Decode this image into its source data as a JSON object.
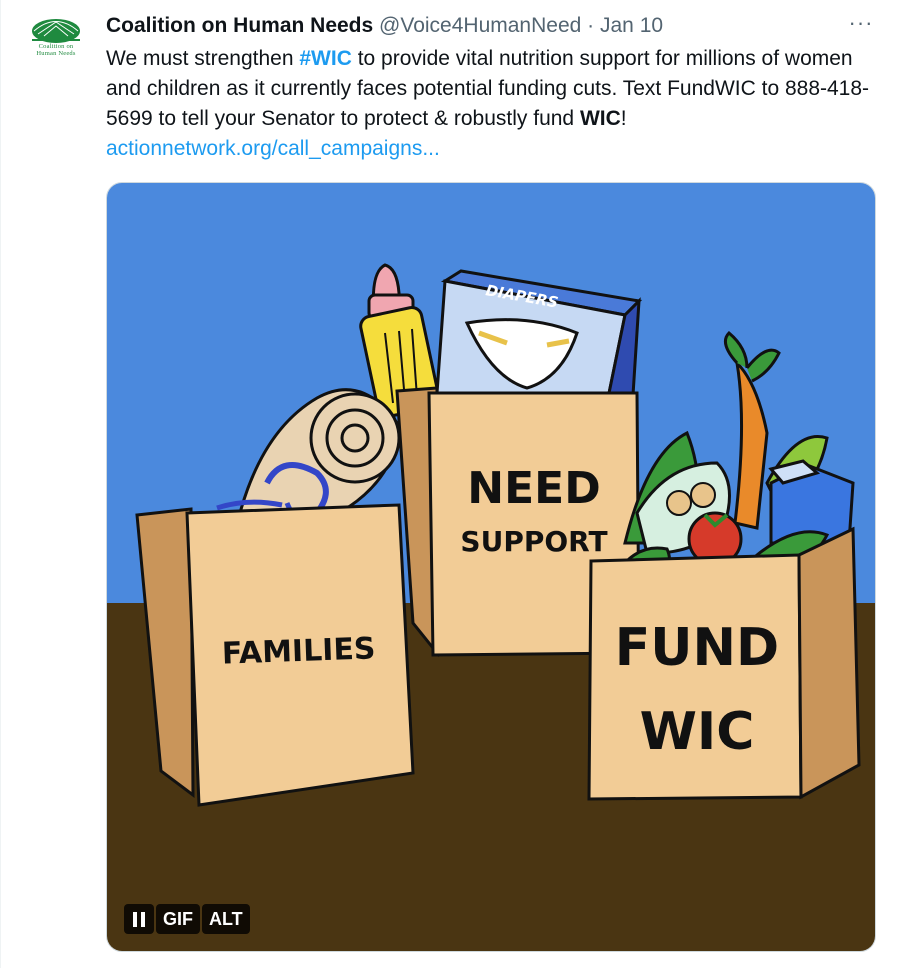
{
  "author": {
    "name": "Coalition on Human Needs",
    "handle": "@Voice4HumanNeed",
    "separator": "·",
    "date": "Jan 10",
    "avatar_line1": "Coalition on",
    "avatar_line2": "Human Needs"
  },
  "more_label": "···",
  "tweet": {
    "text_before_hashtag": "We must strengthen ",
    "hashtag": "#WIC",
    "text_after_hashtag": " to provide vital nutrition support for millions of women and children as it currently faces potential funding cuts. Text FundWIC to 888-418-5699 to tell your Senator to protect & robustly fund ",
    "bold_word": "WIC",
    "exclaim": "! ",
    "link": "actionnetwork.org/call_campaigns..."
  },
  "media": {
    "bag_left_label": "FAMILIES",
    "bag_middle_line1": "NEED",
    "bag_middle_line2": "SUPPORT",
    "bag_right_line1": "FUND",
    "bag_right_line2": "WIC",
    "diapers_label": "DIAPERS",
    "gif_label": "GIF",
    "alt_label": "ALT"
  },
  "colors": {
    "accent": "#1d9bf0",
    "sky": "#4f8ee0",
    "table": "#4a3512",
    "bag": "#f2cc96"
  }
}
